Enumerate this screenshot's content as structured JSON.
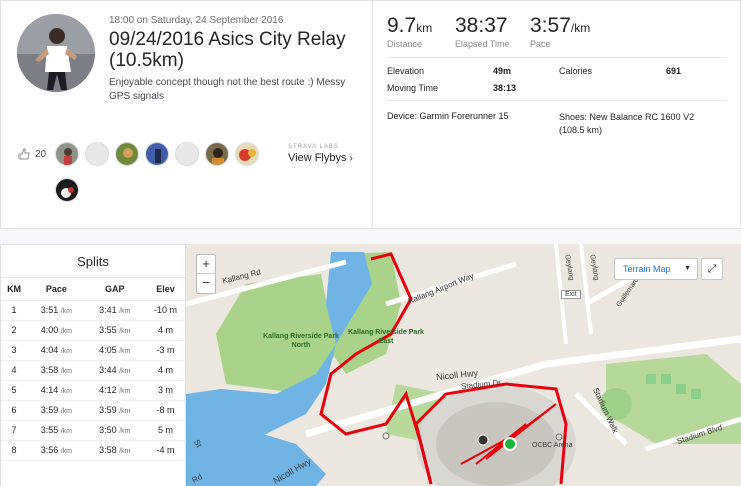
{
  "activity": {
    "datetime": "18:00 on Saturday, 24 September 2016",
    "title": "09/24/2016 Asics City Relay (10.5km)",
    "description": "Enjoyable concept though not the best route :) Messy GPS signals"
  },
  "social": {
    "kudos_count": "20",
    "labs_label": "STRAVA LABS",
    "flyby_label": "View Flybys",
    "athletes": [
      "athlete-1",
      "athlete-2",
      "athlete-3",
      "athlete-4",
      "athlete-5",
      "athlete-6",
      "athlete-7",
      "athlete-8"
    ]
  },
  "stats": {
    "distance": {
      "value": "9.7",
      "unit": "km",
      "label": "Distance"
    },
    "elapsed": {
      "value": "38:37",
      "label": "Elapsed Time"
    },
    "pace": {
      "value": "3:57",
      "unit": "/km",
      "label": "Pace"
    },
    "elevation_label": "Elevation",
    "elevation_value": "49m",
    "calories_label": "Calories",
    "calories_value": "691",
    "moving_label": "Moving Time",
    "moving_value": "38:13",
    "device": "Device: Garmin Forerunner 15",
    "shoes": "Shoes: New Balance RC 1600 V2 (108.5 km)"
  },
  "splits": {
    "title": "Splits",
    "headers": [
      "KM",
      "Pace",
      "GAP",
      "Elev"
    ],
    "rows": [
      {
        "km": "1",
        "pace": "3:51",
        "gap": "3:41",
        "elev": "-10 m"
      },
      {
        "km": "2",
        "pace": "4:00",
        "gap": "3:55",
        "elev": "4 m"
      },
      {
        "km": "3",
        "pace": "4:04",
        "gap": "4:05",
        "elev": "-3 m"
      },
      {
        "km": "4",
        "pace": "3:58",
        "gap": "3:44",
        "elev": "4 m"
      },
      {
        "km": "5",
        "pace": "4:14",
        "gap": "4:12",
        "elev": "3 m"
      },
      {
        "km": "6",
        "pace": "3:59",
        "gap": "3:59",
        "elev": "-8 m"
      },
      {
        "km": "7",
        "pace": "3:55",
        "gap": "3:50",
        "elev": "5 m"
      },
      {
        "km": "8",
        "pace": "3:56",
        "gap": "3:58",
        "elev": "-4 m"
      }
    ],
    "unit": "/km"
  },
  "map": {
    "zoom_in": "+",
    "zoom_out": "−",
    "type_label": "Terrain Map",
    "labels": {
      "kallang_rd": "Kallang Rd",
      "kallang_airport": "Kallang Airport Way",
      "exit": "Exit",
      "park_north": "Kallang Riverside Park North",
      "park_east": "Kallang Riverside Park East",
      "nicoll_hwy": "Nicoll Hwy",
      "nicoll_hwy_2": "Nicoll Hwy",
      "stadium_dr": "Stadium Dr",
      "stadium_walk": "Stadium Walk",
      "stadium_blvd": "Stadium Blvd",
      "ocbc": "OCBC Arena",
      "st": "St",
      "rd": "Rd",
      "geylang_1": "Geylang",
      "geylang_2": "Geylang",
      "guillemard": "Guillemard"
    },
    "colors": {
      "route": "#e8000b",
      "water": "#6fb4e4",
      "park": "#a4d286",
      "road": "#ffffff"
    }
  }
}
